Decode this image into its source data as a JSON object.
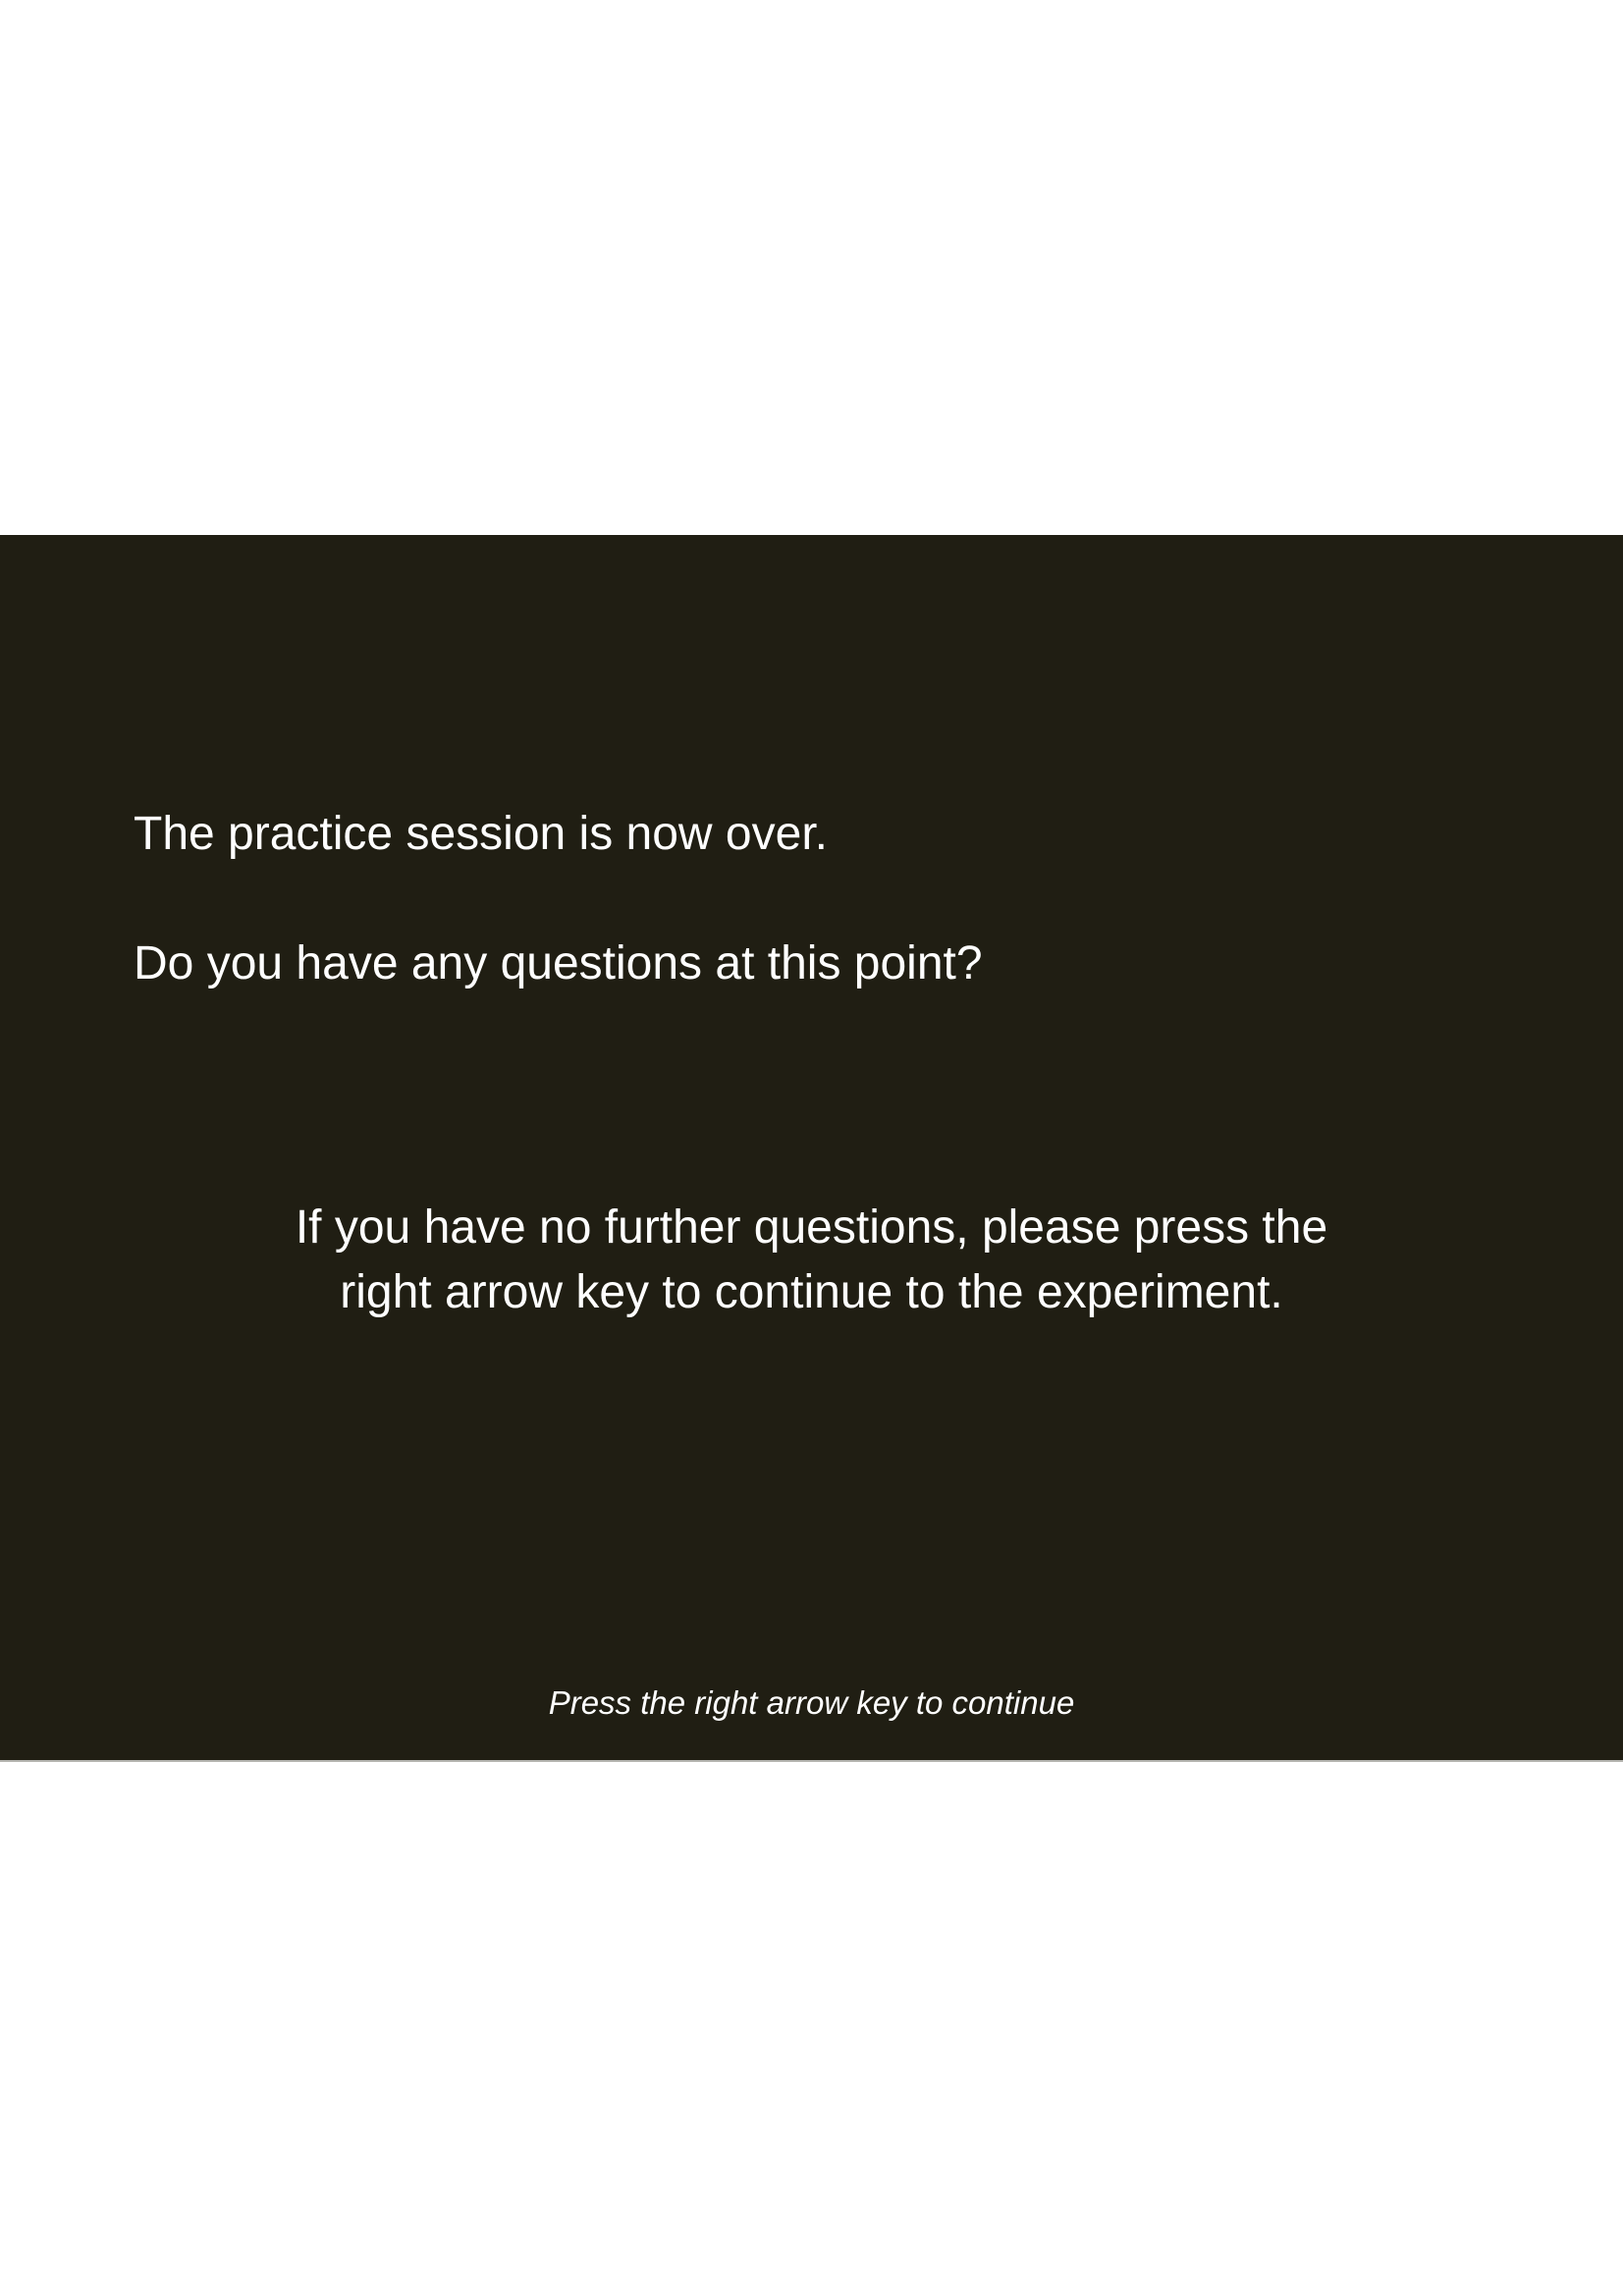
{
  "slide": {
    "background_color": "#201e13",
    "text_color": "#ffffff",
    "intro_line_1": "The practice session is now over.",
    "intro_line_2": "Do you have any questions at this point?",
    "instruction_line_1": "If you have no further questions, please press the",
    "instruction_line_2": "right arrow key to continue to the experiment.",
    "footer_hint": "Press the right arrow key to continue"
  }
}
